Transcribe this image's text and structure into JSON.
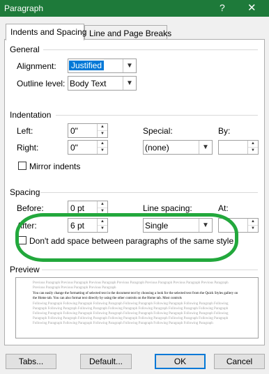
{
  "window": {
    "title": "Paragraph",
    "help_glyph": "?",
    "close_glyph": "✕"
  },
  "tabs": [
    {
      "label": "Indents and Spacing",
      "active": true
    },
    {
      "label": "Line and Page Breaks",
      "active": false
    }
  ],
  "general": {
    "title": "General",
    "alignment_label": "Alignment:",
    "alignment_value": "Justified",
    "outline_label": "Outline level:",
    "outline_value": "Body Text"
  },
  "indentation": {
    "title": "Indentation",
    "left_label": "Left:",
    "left_value": "0\"",
    "right_label": "Right:",
    "right_value": "0\"",
    "special_label": "Special:",
    "special_value": "(none)",
    "by_label": "By:",
    "by_value": "",
    "mirror_label": "Mirror indents",
    "mirror_checked": false
  },
  "spacing": {
    "title": "Spacing",
    "before_label": "Before:",
    "before_value": "0 pt",
    "after_label": "After:",
    "after_value": "6 pt",
    "line_spacing_label": "Line spacing:",
    "line_spacing_value": "Single",
    "at_label": "At:",
    "at_value": "",
    "dont_add_label": "Don't add space between paragraphs of the same style",
    "dont_add_checked": false
  },
  "preview": {
    "title": "Preview",
    "prev_text": "Previous Paragraph Previous Paragraph Previous Paragraph Previous Paragraph Previous Paragraph Previous Paragraph Previous Paragraph Previous Paragraph Previous Paragraph Previous Paragraph",
    "sample_text": "You can easily change the formatting of selected text in the document text by choosing a look for the selected text from the Quick Styles gallery on the Home tab. You can also format text directly by using the other controls on the Home tab. Most controls",
    "following_text": "Following Paragraph Following Paragraph Following Paragraph Following Paragraph Following Paragraph Following Paragraph Following Paragraph Following Paragraph Following Paragraph Following Paragraph Following Paragraph Following Paragraph Following Paragraph Following Paragraph Following Paragraph Following Paragraph Following Paragraph Following Paragraph Following Paragraph Following Paragraph Following Paragraph Following Paragraph Following Paragraph Following Paragraph Following Paragraph Following Paragraph Following Paragraph Following Paragraph Following Paragraph Following Paragraph Following Paragraph Following Paragraph"
  },
  "buttons": {
    "tabs": "Tabs...",
    "default": "Default...",
    "ok": "OK",
    "cancel": "Cancel"
  },
  "colors": {
    "titlebar": "#1e7a3a",
    "selection": "#0078d7",
    "annotation": "#22a83c"
  }
}
